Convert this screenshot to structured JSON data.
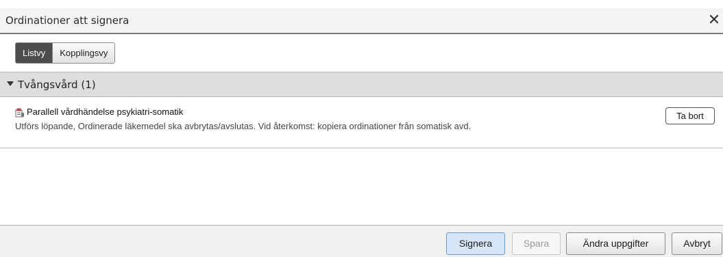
{
  "dialog": {
    "title": "Ordinationer att signera",
    "close_icon": "close-icon"
  },
  "view_toggle": {
    "options": [
      {
        "label": "Listvy",
        "active": true
      },
      {
        "label": "Kopplingsvy",
        "active": false
      }
    ]
  },
  "group": {
    "title": "Tvångsvård (1)",
    "expanded": true,
    "caret_icon": "caret-down-icon"
  },
  "items": [
    {
      "icon": "order-icon",
      "title": "Parallell vårdhändelse psykiatri-somatik",
      "description": "Utförs löpande, Ordinerade läkemedel ska avbrytas/avslutas. Vid återkomst: kopiera ordinationer från somatisk avd.",
      "remove_label": "Ta bort"
    }
  ],
  "footer": {
    "sign_label": "Signera",
    "save_label": "Spara",
    "edit_label": "Ändra uppgifter",
    "cancel_label": "Avbryt"
  },
  "colors": {
    "primary_button_bg": "#d6e6f7",
    "primary_button_border": "#6d9bd1",
    "active_segment": "#4d4d4d",
    "group_header_bg": "#dedede"
  }
}
